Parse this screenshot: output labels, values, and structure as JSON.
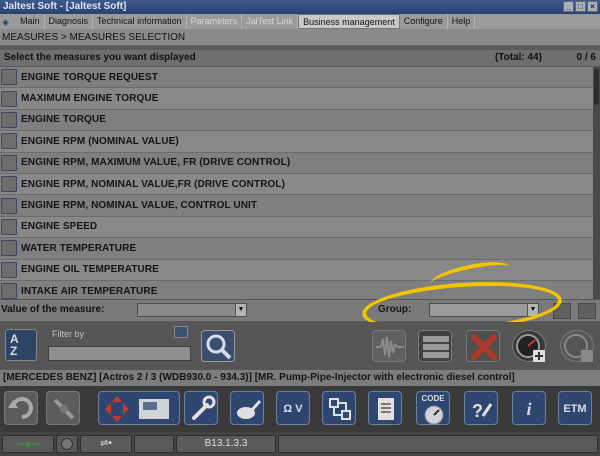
{
  "window": {
    "title": "Jaltest Soft - [Jaltest Soft]"
  },
  "menu": {
    "items": [
      {
        "label": "Main",
        "state": "normal"
      },
      {
        "label": "Diagnosis",
        "state": "normal"
      },
      {
        "label": "Technical information",
        "state": "normal"
      },
      {
        "label": "Parameters",
        "state": "disabled"
      },
      {
        "label": "JalTest Link",
        "state": "disabled"
      },
      {
        "label": "Business management",
        "state": "active"
      },
      {
        "label": "Configure",
        "state": "normal"
      },
      {
        "label": "Help",
        "state": "normal"
      }
    ]
  },
  "breadcrumb": "MEASURES > MEASURES SELECTION",
  "list_header": {
    "instruction": "Select the measures you want displayed",
    "total": "(Total: 44)",
    "selected_count": "0 / 6"
  },
  "measures": [
    "ENGINE TORQUE REQUEST",
    "MAXIMUM ENGINE TORQUE",
    "ENGINE TORQUE",
    "ENGINE RPM (NOMINAL VALUE)",
    "ENGINE RPM, MAXIMUM VALUE, FR (DRIVE CONTROL)",
    "ENGINE RPM, NOMINAL VALUE,FR (DRIVE CONTROL)",
    "ENGINE RPM, NOMINAL VALUE, CONTROL UNIT",
    "ENGINE SPEED",
    "WATER TEMPERATURE",
    "ENGINE OIL TEMPERATURE",
    "INTAKE AIR TEMPERATURE"
  ],
  "value_bar": {
    "value_label": "Value of the measure:",
    "group_label": "Group:",
    "value_selected": "",
    "group_selected": ""
  },
  "filter": {
    "label": "Filter by",
    "value": ""
  },
  "sort_button": {
    "top": "A",
    "bottom": "Z"
  },
  "vehicle_info": "[MERCEDES BENZ] [Actros 2 / 3 (WDB930.0 - 934.3)] [MR. Pump-Pipe-Injector with electronic diesel control]",
  "bottom_buttons": {
    "code_label": "CODE",
    "etm_label": "ETM",
    "info_label": "i",
    "units_label": "Ω V"
  },
  "status": {
    "version": "B13.1.3.3"
  },
  "colors": {
    "highlight": "#f2c500",
    "delete_red": "#c0392b"
  }
}
